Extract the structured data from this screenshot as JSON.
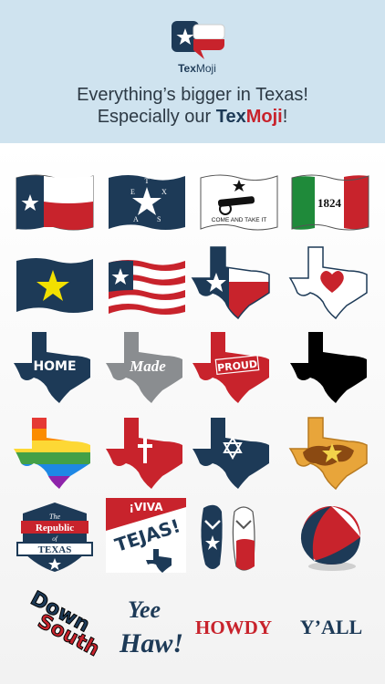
{
  "app": {
    "logo_part1": "Tex",
    "logo_part2": "Moji"
  },
  "tagline": {
    "line1": "Everything’s bigger in Texas!",
    "line2_prefix": "Especially our ",
    "brand_part1": "Tex",
    "brand_part2": "Moji",
    "line2_suffix": "!"
  },
  "stickers": {
    "cannon_flag": "COME AND TAKE IT",
    "mexico_flag": "1824",
    "home": "HOME",
    "made": "Made",
    "proud": "PROUD",
    "republic_1": "The",
    "republic_2": "Republic",
    "republic_3": "of",
    "republic_4": "TEXAS",
    "viva_1": "¡VIVA",
    "viva_2": "TEJAS!",
    "down_1": "Down",
    "down_2": "South",
    "yee": "Yee",
    "haw": "Haw!",
    "howdy": "HOWDY",
    "yall": "Y’ALL"
  },
  "colors": {
    "navy": "#1d3a57",
    "red": "#c8232c",
    "header_bg": "#cfe3ef"
  }
}
